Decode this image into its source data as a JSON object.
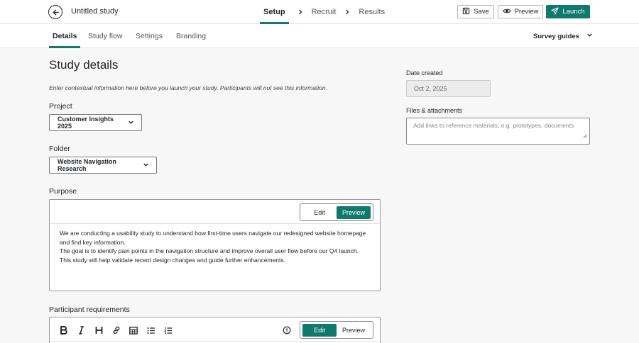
{
  "header": {
    "study_title": "Untitled study",
    "steps": [
      "Setup",
      "Recruit",
      "Results"
    ],
    "save_label": "Save",
    "preview_label": "Preview",
    "launch_label": "Launch"
  },
  "tabs": {
    "items": [
      "Details",
      "Study flow",
      "Settings",
      "Branding"
    ],
    "active": "Details",
    "survey_guides_label": "Survey guides"
  },
  "main": {
    "title": "Study details",
    "intro": "Enter contextual information here before you launch your study. Participants will not see this information.",
    "project_label": "Project",
    "project_value": "Customer Insights 2025",
    "folder_label": "Folder",
    "folder_value": "Website Navigation Research",
    "purpose_label": "Purpose",
    "purpose_edit_label": "Edit",
    "purpose_preview_label": "Preview",
    "purpose_text": [
      "We are conducting a usability study to understand how first-time users navigate our redesigned website homepage",
      "and find key information.",
      "The goal is to identify pain points in the navigation structure and improve overall user flow before our Q4 launch.",
      "This study will help validate recent design changes and guide further enhancements."
    ],
    "participant_label": "Participant requirements",
    "participant_edit_label": "Edit",
    "participant_preview_label": "Preview"
  },
  "side": {
    "date_label": "Date created",
    "date_value": "Oct 2, 2025",
    "files_label": "Files & attachments",
    "files_placeholder": "Add links to reference materials, e.g. prototypes, documents"
  },
  "colors": {
    "accent": "#0e7a6d"
  }
}
